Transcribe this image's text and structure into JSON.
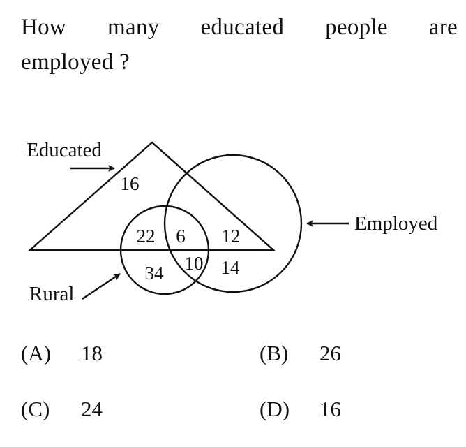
{
  "question": {
    "line1": "How many educated people are",
    "line2": "employed ?"
  },
  "diagram": {
    "labels": {
      "educated": "Educated",
      "employed": "Employed",
      "rural": "Rural"
    },
    "regions": {
      "educated_only": "16",
      "educated_rural": "22",
      "educated_rural_employed": "6",
      "educated_employed": "12",
      "rural_only": "34",
      "rural_employed": "10",
      "employed_only": "14"
    }
  },
  "options": [
    {
      "letter": "(A)",
      "value": "18"
    },
    {
      "letter": "(B)",
      "value": "26"
    },
    {
      "letter": "(C)",
      "value": "24"
    },
    {
      "letter": "(D)",
      "value": "16"
    }
  ]
}
